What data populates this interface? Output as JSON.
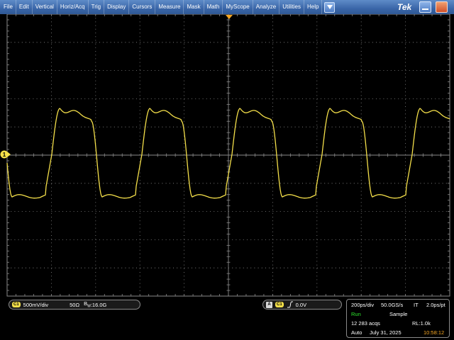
{
  "menu": {
    "items": [
      "File",
      "Edit",
      "Vertical",
      "Horiz/Acq",
      "Trig",
      "Display",
      "Cursors",
      "Measure",
      "Mask",
      "Math",
      "MyScope",
      "Analyze",
      "Utilities",
      "Help"
    ]
  },
  "brand": "Tek",
  "channel1": {
    "badge": "C1",
    "scale": "500mV/div",
    "impedance": "50Ω",
    "bandwidth_prefix": "B",
    "bandwidth_sub": "W",
    "bandwidth_value": ":16.0G",
    "marker_label": "1",
    "color": "#f5e04a"
  },
  "trigger": {
    "source_badge": "A",
    "channel_badge": "C1",
    "slope": "rising",
    "level": "0.0V"
  },
  "acquisition": {
    "timebase": "200ps/div",
    "sample_rate": "50.0GS/s",
    "mode_flag": "IT",
    "resolution": "2.0ps/pt",
    "run_state": "Run",
    "acq_mode": "Sample",
    "acq_count": "12 283 acqs",
    "record_length": "RL:1.0k",
    "trigger_mode": "Auto",
    "date": "July 31, 2025",
    "time": "10:58:12",
    "run_color": "#2ee62e",
    "time_color": "#f5a623"
  },
  "colors": {
    "grid": "#8a8a8a",
    "trace": "#f5e04a",
    "trigger_marker": "#f5a623",
    "menubar": "#3a66a8"
  }
}
